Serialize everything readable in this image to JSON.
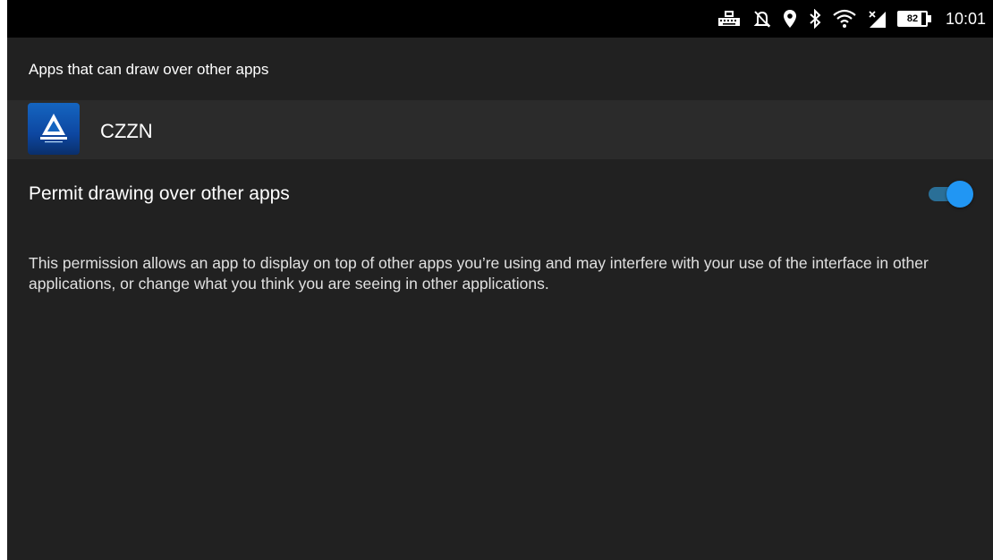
{
  "status_bar": {
    "time": "10:01",
    "battery_level": "82",
    "battery_fraction": 0.82,
    "icons": [
      "keyboard-icon",
      "notifications-off-icon",
      "location-icon",
      "bluetooth-icon",
      "wifi-icon",
      "cellular-no-signal-icon",
      "battery-icon"
    ]
  },
  "app_bar": {
    "title": "Apps that can draw over other apps"
  },
  "app": {
    "name": "CZZN"
  },
  "permission": {
    "label": "Permit drawing over other apps",
    "enabled": true,
    "accent_color": "#2196f3"
  },
  "description": "This permission allows an app to display on top of other apps you’re using and may interfere with your use of the interface in other applications, or change what you think you are seeing in other applications.",
  "colors": {
    "background": "#212121",
    "status_bar": "#000000",
    "app_row": "#2b2b2b"
  }
}
